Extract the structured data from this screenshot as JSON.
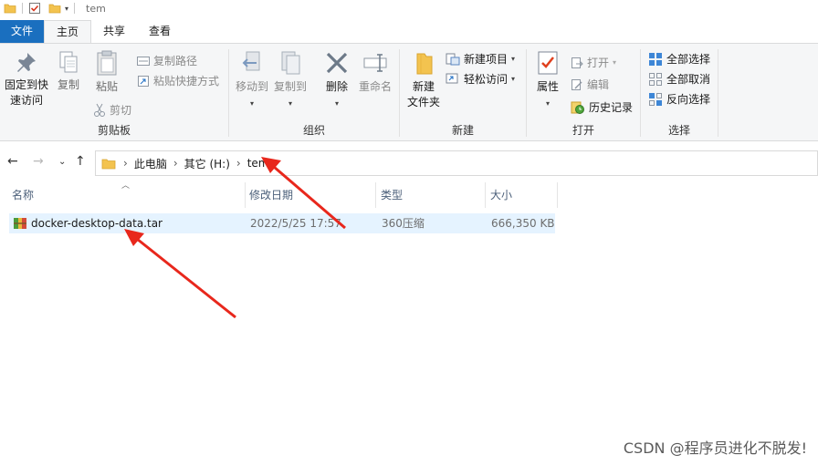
{
  "window": {
    "title": "tem"
  },
  "tabs": [
    {
      "label": "文件"
    },
    {
      "label": "主页"
    },
    {
      "label": "共享"
    },
    {
      "label": "查看"
    }
  ],
  "ribbon": {
    "clipboard": {
      "label": "剪贴板",
      "pin": "固定到快速访问",
      "pin_line1": "固定到快",
      "pin_line2": "速访问",
      "copy": "复制",
      "paste": "粘贴",
      "copy_path": "复制路径",
      "paste_shortcut": "粘贴快捷方式",
      "cut": "剪切"
    },
    "organize": {
      "label": "组织",
      "move_to": "移动到",
      "copy_to": "复制到",
      "delete": "删除",
      "rename": "重命名"
    },
    "new": {
      "label": "新建",
      "new_item": "新建项目",
      "easy_access": "轻松访问",
      "new_folder_line1": "新建",
      "new_folder_line2": "文件夹"
    },
    "open": {
      "label": "打开",
      "properties": "属性",
      "open": "打开",
      "edit": "编辑",
      "history": "历史记录"
    },
    "select": {
      "label": "选择",
      "select_all": "全部选择",
      "select_none": "全部取消",
      "invert": "反向选择"
    }
  },
  "address": {
    "crumbs": [
      "此电脑",
      "其它 (H:)",
      "tem"
    ]
  },
  "columns": {
    "name": "名称",
    "modified": "修改日期",
    "type": "类型",
    "size": "大小"
  },
  "files": [
    {
      "name": "docker-desktop-data.tar",
      "modified": "2022/5/25 17:57",
      "type": "360压缩",
      "size": "666,350 KB"
    }
  ],
  "watermark": "CSDN @程序员进化不脱发!",
  "colors": {
    "file_tab": "#1a6fbf",
    "selection": "#e5f3ff",
    "annotation_arrow": "#e8271c"
  }
}
